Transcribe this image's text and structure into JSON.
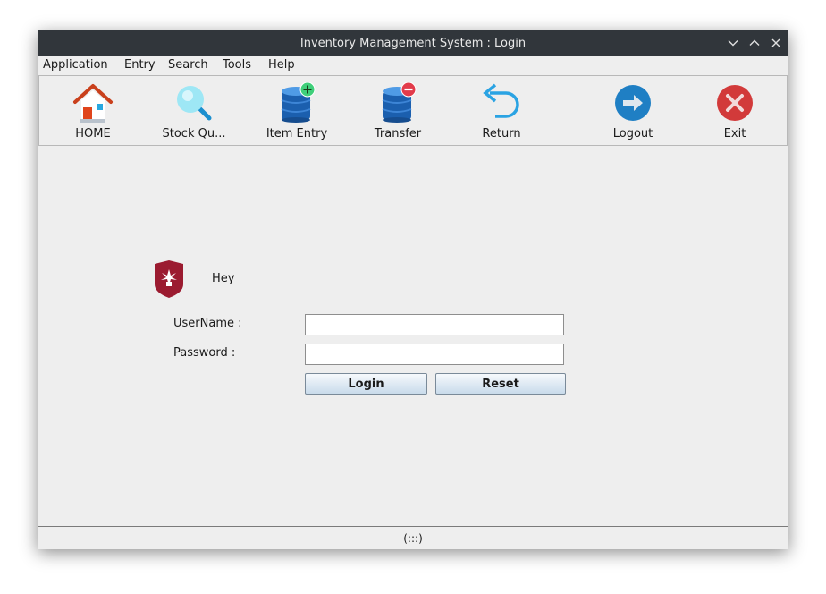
{
  "window": {
    "title": "Inventory Management System : Login"
  },
  "menubar": {
    "items": [
      {
        "label": "Application"
      },
      {
        "label": "Entry"
      },
      {
        "label": "Search"
      },
      {
        "label": "Tools"
      },
      {
        "label": "Help"
      }
    ]
  },
  "toolbar": {
    "items": [
      {
        "label": "HOME",
        "icon": "home-icon"
      },
      {
        "label": "Stock Qu...",
        "icon": "search-icon"
      },
      {
        "label": "Item Entry",
        "icon": "database-add-icon"
      },
      {
        "label": "Transfer",
        "icon": "database-remove-icon"
      },
      {
        "label": "Return",
        "icon": "return-arrow-icon"
      },
      {
        "label": "Logout",
        "icon": "logout-arrow-icon"
      },
      {
        "label": "Exit",
        "icon": "exit-x-icon"
      }
    ]
  },
  "login": {
    "greeting": "Hey",
    "username_label": "UserName :",
    "username_value": "",
    "password_label": "Password :",
    "password_value": "",
    "login_label": "Login",
    "reset_label": "Reset"
  },
  "status": {
    "text": "-(:::)-"
  },
  "colors": {
    "titlebar": "#31363b",
    "window_bg": "#eeeeee",
    "logo_red": "#9b1b30",
    "exit_red": "#d23a3a",
    "logout_blue": "#1f7fc4",
    "db_blue": "#1b5fae"
  }
}
